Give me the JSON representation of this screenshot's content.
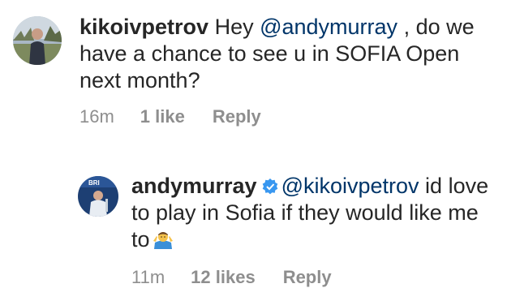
{
  "comments": [
    {
      "username": "kikoivpetrov",
      "verified": false,
      "text_before": " Hey ",
      "mention": "@andymurray",
      "text_after": " , do we have a chance to see u in SOFIA Open next month?",
      "time": "16m",
      "likes": "1 like",
      "reply": "Reply"
    },
    {
      "username": "andymurray",
      "verified": true,
      "mention": "@kikoivpetrov",
      "text_after": " id love to play in Sofia if they would like me to",
      "emoji": "person-shrugging-emoji",
      "time": "11m",
      "likes": "12 likes",
      "reply": "Reply"
    }
  ],
  "colors": {
    "text": "#262626",
    "mention": "#003569",
    "meta": "#8e8e8e",
    "verified": "#3897f0"
  }
}
